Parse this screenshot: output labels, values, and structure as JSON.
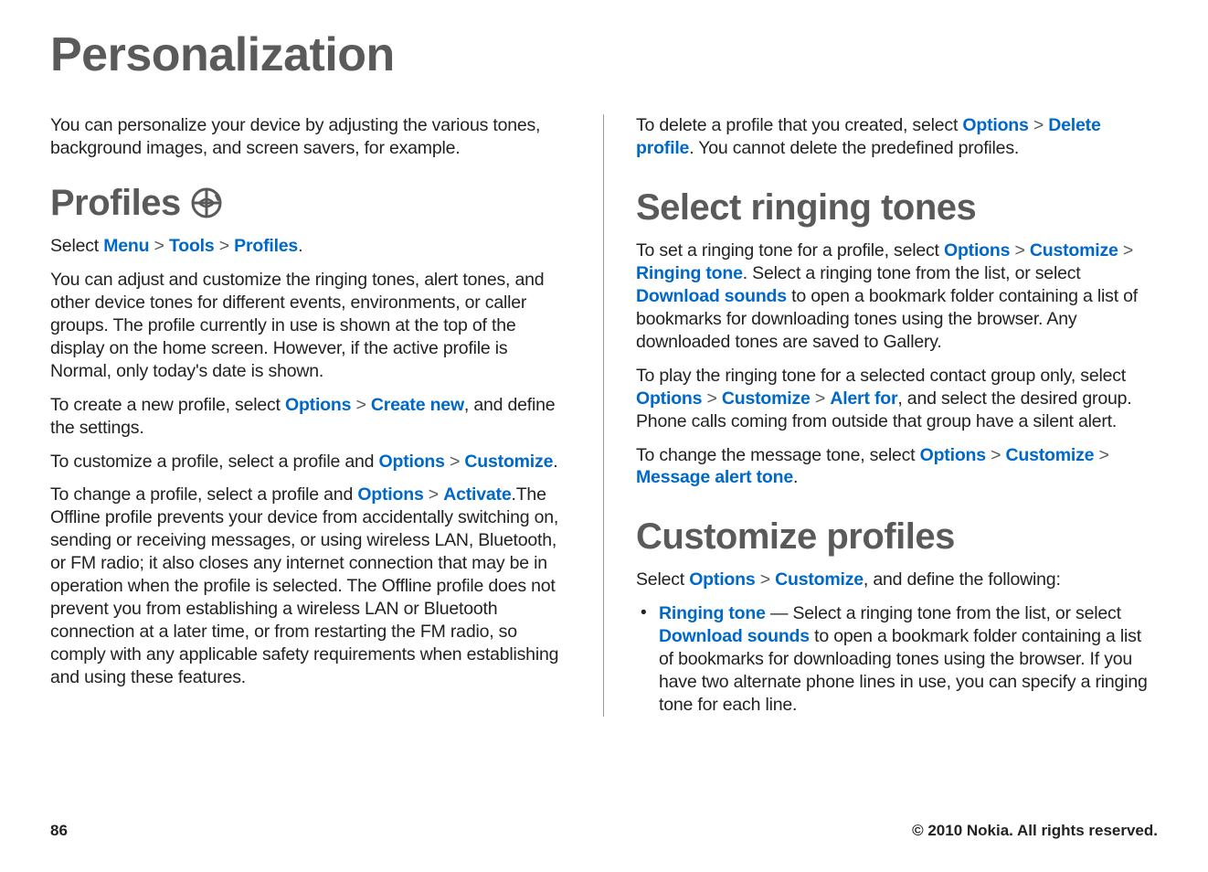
{
  "title": "Personalization",
  "intro": "You can personalize your device by adjusting the various tones, background images, and screen savers, for example.",
  "profiles": {
    "heading": "Profiles",
    "nav_prefix": "Select ",
    "nav_menu": "Menu",
    "nav_tools": "Tools",
    "nav_profiles": "Profiles",
    "nav_end": ".",
    "body1": "You can adjust and customize the ringing tones, alert tones, and other device tones for different events, environments, or caller groups. The profile currently in use is shown at the top of the display on the home screen. However, if the active profile is Normal, only today's date is shown.",
    "create_prefix": "To create a new profile, select ",
    "create_options": "Options",
    "create_new": "Create new",
    "create_suffix": ", and define the settings.",
    "customize_prefix": "To customize a profile, select a profile and ",
    "customize_options": "Options",
    "customize_link": "Customize",
    "customize_end": ".",
    "change_prefix": "To change a profile, select a profile and ",
    "change_options": "Options",
    "change_activate": "Activate",
    "change_suffix": ".The Offline profile prevents your device from accidentally switching on, sending or receiving messages, or using wireless LAN, Bluetooth, or FM radio; it also closes any internet connection that may be in operation when the profile is selected. The Offline profile does not prevent you from establishing a wireless LAN or Bluetooth connection at a later time, or from restarting the FM radio, so comply with any applicable safety requirements when establishing and using these features.",
    "delete_prefix": "To delete a profile that you created, select ",
    "delete_options": "Options",
    "delete_profile": "Delete profile",
    "delete_suffix": ". You cannot delete the predefined profiles."
  },
  "ringing": {
    "heading": "Select ringing tones",
    "p1_pre": "To set a ringing tone for a profile, select ",
    "p1_options": "Options",
    "p1_customize": "Customize",
    "p1_ringing": "Ringing tone",
    "p1_mid": ". Select a ringing tone from the list, or select ",
    "p1_download": "Download sounds",
    "p1_suffix": " to open a bookmark folder containing a list of bookmarks for downloading tones using the browser. Any downloaded tones are saved to Gallery.",
    "p2_pre": "To play the ringing tone for a selected contact group only, select ",
    "p2_options": "Options",
    "p2_customize": "Customize",
    "p2_alert": "Alert for",
    "p2_suffix": ", and select the desired group. Phone calls coming from outside that group have a silent alert.",
    "p3_pre": "To change the message tone, select ",
    "p3_options": "Options",
    "p3_customize": "Customize",
    "p3_msg": "Message alert tone",
    "p3_end": "."
  },
  "custom": {
    "heading": "Customize profiles",
    "p1_pre": "Select ",
    "p1_options": "Options",
    "p1_customize": "Customize",
    "p1_suffix": ", and define the following:",
    "li_ringing": "Ringing tone",
    "li_dash": "  —  Select a ringing tone from the list, or select ",
    "li_download": "Download sounds",
    "li_suffix": " to open a bookmark folder containing a list of bookmarks for downloading tones using the browser. If you have two alternate phone lines in use, you can specify a ringing tone for each line."
  },
  "footer": {
    "page": "86",
    "copyright": "© 2010 Nokia. All rights reserved."
  },
  "sep": " > "
}
